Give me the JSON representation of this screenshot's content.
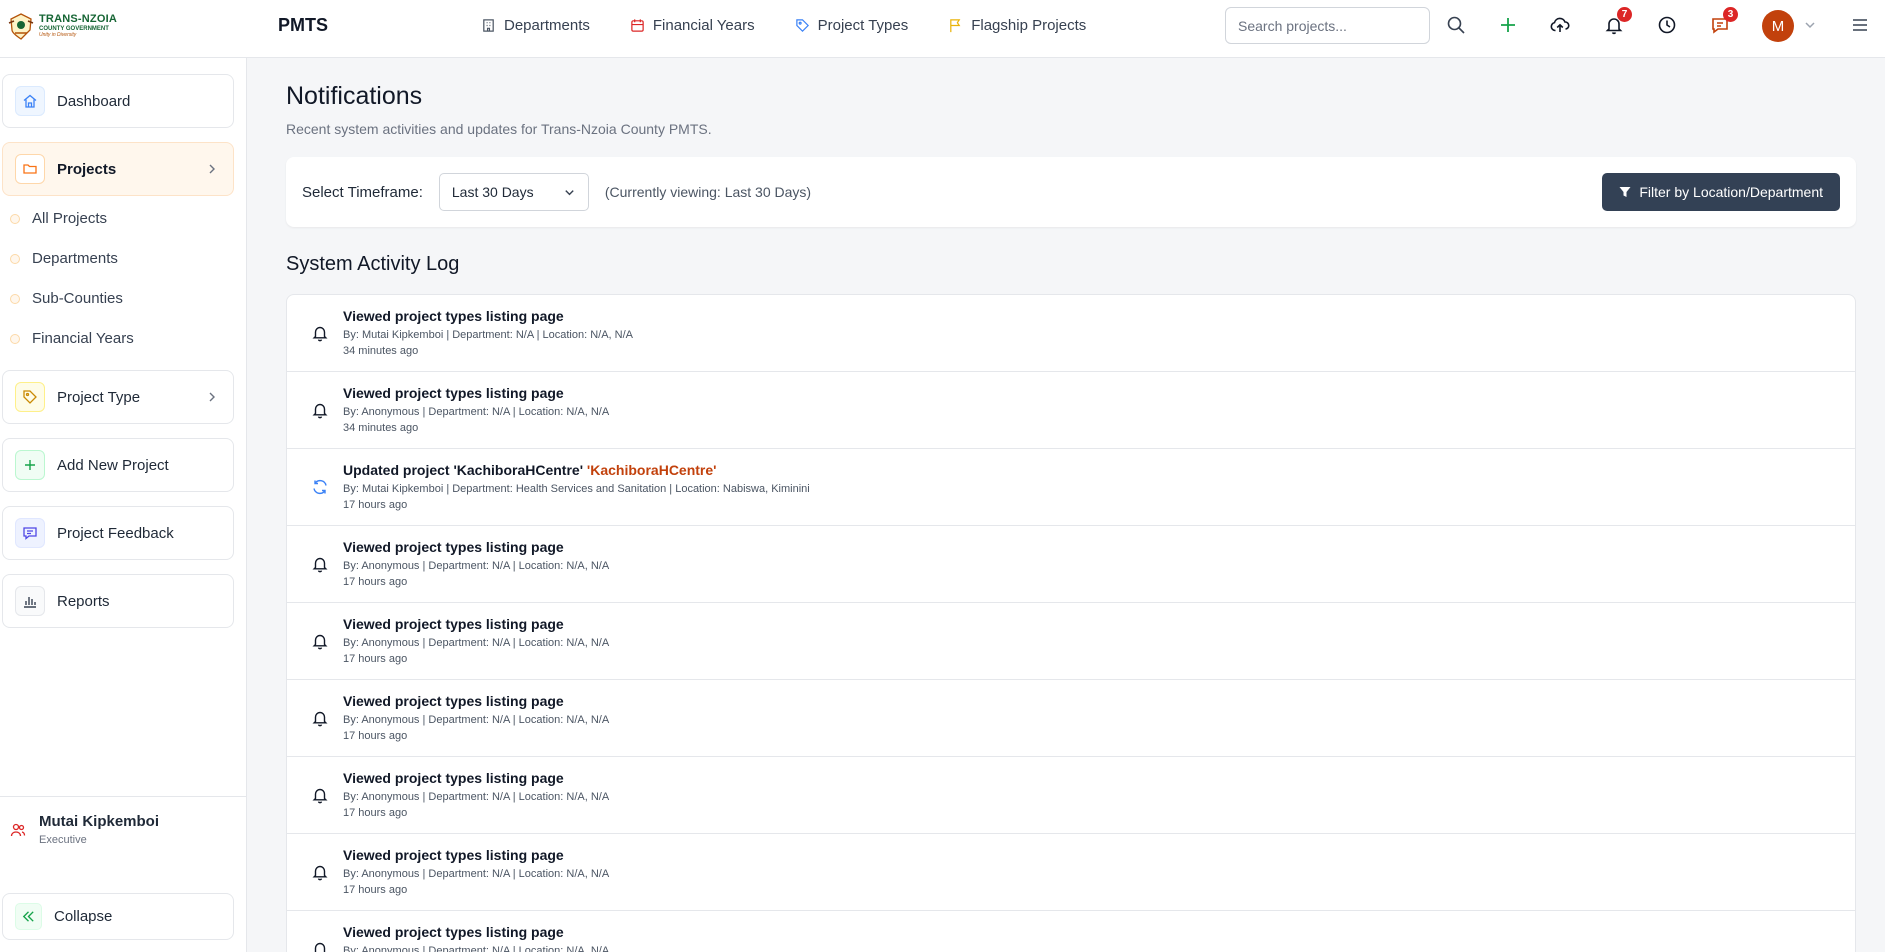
{
  "brand": {
    "line1": "TRANS-NZOIA",
    "line2": "COUNTY GOVERNMENT",
    "line3": "Unity in Diversity"
  },
  "app_title": "PMTS",
  "top_nav": [
    {
      "label": "Departments",
      "icon": "building-icon"
    },
    {
      "label": "Financial Years",
      "icon": "calendar-icon"
    },
    {
      "label": "Project Types",
      "icon": "tag-icon"
    },
    {
      "label": "Flagship Projects",
      "icon": "flag-icon"
    }
  ],
  "search": {
    "placeholder": "Search projects...",
    "value": ""
  },
  "badges": {
    "notifications": "7",
    "messages": "3"
  },
  "user_avatar_initial": "M",
  "sidebar": {
    "dashboard": "Dashboard",
    "projects": "Projects",
    "sub_items": [
      "All Projects",
      "Departments",
      "Sub-Counties",
      "Financial Years"
    ],
    "project_type": "Project Type",
    "add_new_project": "Add New Project",
    "project_feedback": "Project Feedback",
    "reports": "Reports",
    "user_name": "Mutai Kipkemboi",
    "user_role": "Executive",
    "collapse": "Collapse"
  },
  "main": {
    "title": "Notifications",
    "subtitle": "Recent system activities and updates for Trans-Nzoia County PMTS.",
    "timeframe_label": "Select Timeframe:",
    "timeframe_value": "Last 30 Days",
    "timeframe_current": "(Currently viewing: Last 30 Days)",
    "filter_button": "Filter by Location/Department",
    "log_title": "System Activity Log"
  },
  "activity_log": [
    {
      "icon": "bell-icon",
      "title": "Viewed project types listing page",
      "highlight": "",
      "meta": "By: Mutai Kipkemboi | Department: N/A | Location: N/A, N/A",
      "time": "34 minutes ago"
    },
    {
      "icon": "bell-icon",
      "title": "Viewed project types listing page",
      "highlight": "",
      "meta": "By: Anonymous | Department: N/A | Location: N/A, N/A",
      "time": "34 minutes ago"
    },
    {
      "icon": "refresh-icon",
      "title": "Updated project 'KachiboraHCentre'",
      "highlight": "'KachiboraHCentre'",
      "meta": "By: Mutai Kipkemboi | Department: Health Services and Sanitation | Location: Nabiswa, Kiminini",
      "time": "17 hours ago"
    },
    {
      "icon": "bell-icon",
      "title": "Viewed project types listing page",
      "highlight": "",
      "meta": "By: Anonymous | Department: N/A | Location: N/A, N/A",
      "time": "17 hours ago"
    },
    {
      "icon": "bell-icon",
      "title": "Viewed project types listing page",
      "highlight": "",
      "meta": "By: Anonymous | Department: N/A | Location: N/A, N/A",
      "time": "17 hours ago"
    },
    {
      "icon": "bell-icon",
      "title": "Viewed project types listing page",
      "highlight": "",
      "meta": "By: Anonymous | Department: N/A | Location: N/A, N/A",
      "time": "17 hours ago"
    },
    {
      "icon": "bell-icon",
      "title": "Viewed project types listing page",
      "highlight": "",
      "meta": "By: Anonymous | Department: N/A | Location: N/A, N/A",
      "time": "17 hours ago"
    },
    {
      "icon": "bell-icon",
      "title": "Viewed project types listing page",
      "highlight": "",
      "meta": "By: Anonymous | Department: N/A | Location: N/A, N/A",
      "time": "17 hours ago"
    },
    {
      "icon": "bell-icon",
      "title": "Viewed project types listing page",
      "highlight": "",
      "meta": "By: Anonymous | Department: N/A | Location: N/A, N/A",
      "time": ""
    }
  ],
  "colors": {
    "accent": "#c2410c",
    "dark_button": "#334155",
    "badge": "#dc2626",
    "add_green": "#16a34a"
  }
}
